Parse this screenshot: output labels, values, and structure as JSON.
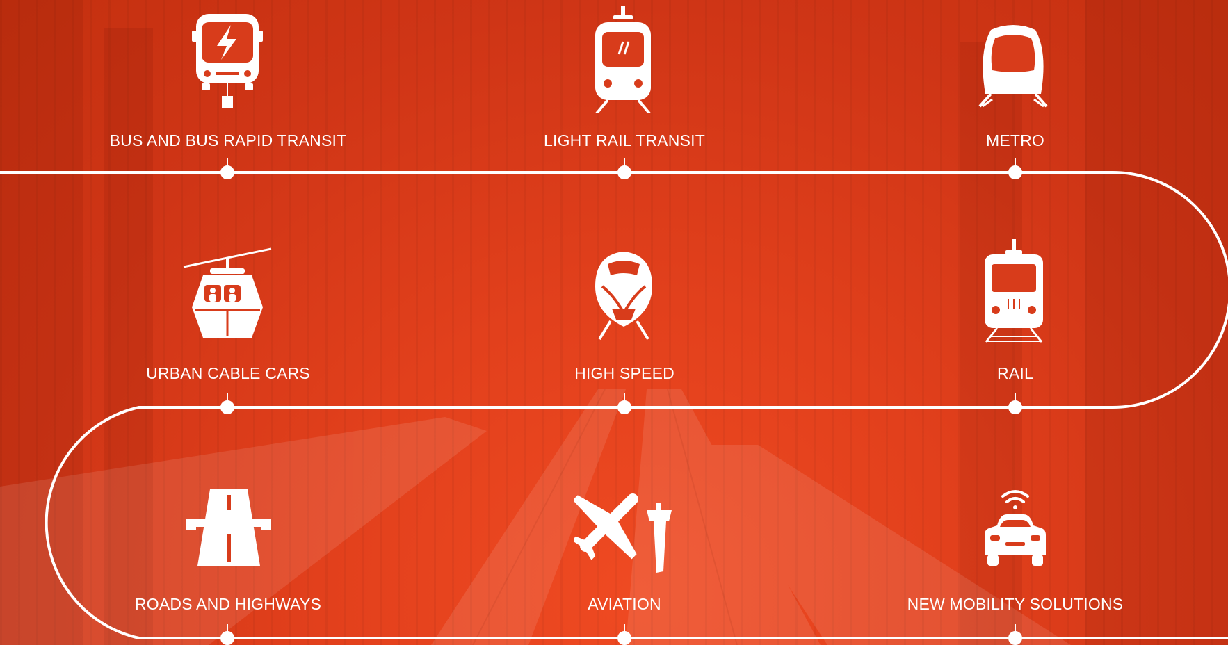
{
  "background": {
    "tint": "#e03e1b",
    "line_color": "#ffffff"
  },
  "modes": [
    {
      "id": "bus",
      "label": "BUS AND BUS RAPID TRANSIT",
      "icon": "electric-bus-icon"
    },
    {
      "id": "lrt",
      "label": "LIGHT RAIL TRANSIT",
      "icon": "light-rail-icon"
    },
    {
      "id": "metro",
      "label": "METRO",
      "icon": "metro-train-icon"
    },
    {
      "id": "cable",
      "label": "URBAN CABLE CARS",
      "icon": "cable-car-icon"
    },
    {
      "id": "hsr",
      "label": "HIGH SPEED",
      "icon": "high-speed-train-icon"
    },
    {
      "id": "rail",
      "label": "RAIL",
      "icon": "rail-train-icon"
    },
    {
      "id": "roads",
      "label": "ROADS AND HIGHWAYS",
      "icon": "highway-icon"
    },
    {
      "id": "aviation",
      "label": "AVIATION",
      "icon": "airplane-tower-icon"
    },
    {
      "id": "mobility",
      "label": "NEW MOBILITY SOLUTIONS",
      "icon": "connected-car-icon"
    }
  ]
}
